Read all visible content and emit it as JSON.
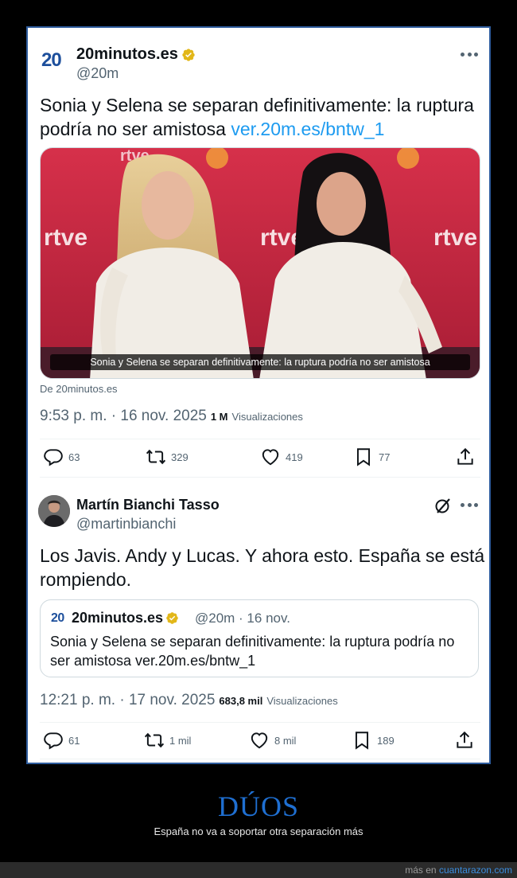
{
  "tweet1": {
    "logo": "20",
    "name": "20minutos.es",
    "handle": "@20m",
    "text": "Sonia y Selena se separan definitivamente: la ruptura podría no ser amistosa",
    "link": "ver.20m.es/bntw_1",
    "media_caption": "Sonia y Selena se separan definitivamente: la ruptura podría no ser amistosa",
    "source": "De 20minutos.es",
    "time": "9:53 p. m. · 16 nov. 2025",
    "views_count": "1 M",
    "views_label": "Visualizaciones",
    "replies": "63",
    "retweets": "329",
    "likes": "419",
    "bookmarks": "77"
  },
  "tweet2": {
    "name": "Martín Bianchi Tasso",
    "handle": "@martinbianchi",
    "text": "Los Javis. Andy y Lucas. Y ahora esto. España se está rompiendo.",
    "quote": {
      "logo": "20",
      "name": "20minutos.es",
      "handle_date": "@20m · 16 nov.",
      "text": "Sonia y Selena se separan definitivamente: la ruptura podría no ser amistosa ver.20m.es/bntw_1"
    },
    "time": "12:21 p. m. · 17 nov. 2025",
    "views_count": "683,8 mil",
    "views_label": "Visualizaciones",
    "replies": "61",
    "retweets": "1 mil",
    "likes": "8 mil",
    "bookmarks": "189"
  },
  "footer": {
    "title": "DÚOS",
    "subtitle": "España no va a soportar otra separación más",
    "credit_prefix": "más en",
    "credit_link": "cuantarazon.com"
  },
  "icons": {
    "verified": "verified-gold-badge-icon",
    "more": "more-dots-icon",
    "reply": "reply-bubble-icon",
    "retweet": "retweet-icon",
    "like": "heart-icon",
    "bookmark": "bookmark-icon",
    "share": "share-upload-icon",
    "grok": "grok-icon"
  },
  "colors": {
    "link": "#1d9bf0",
    "brand_20": "#1d4f9c",
    "verified_gold": "#e2b719",
    "title_blue": "#1f6fd1",
    "card_border": "#2f5d9e"
  }
}
